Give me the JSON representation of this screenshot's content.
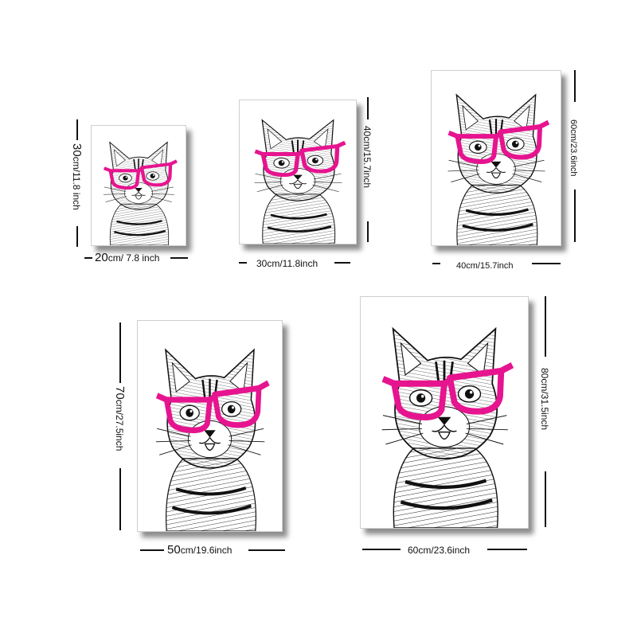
{
  "colors": {
    "glasses": "#e6148f",
    "ink": "#111111",
    "frame_border": "#cfcfcf"
  },
  "art": {
    "subject": "cat-with-pink-glasses"
  },
  "sizes": [
    {
      "width_big": "20",
      "width_rest": "cm/ 7.8 inch",
      "height_big": "30",
      "height_rest": "cm/11.8 inch"
    },
    {
      "width_big": "",
      "width_rest": "30cm/11.8inch",
      "height_big": "",
      "height_rest": "40cm/15.7inch"
    },
    {
      "width_big": "",
      "width_rest": "40cm/15.7inch",
      "height_big": "",
      "height_rest": "60cm/23.6inch"
    },
    {
      "width_big": "50",
      "width_rest": "cm/19.6inch",
      "height_big": "70",
      "height_rest": "cm/27.5inch"
    },
    {
      "width_big": "",
      "width_rest": "60cm/23.6inch",
      "height_big": "",
      "height_rest": "80cm/31.5inch"
    }
  ]
}
